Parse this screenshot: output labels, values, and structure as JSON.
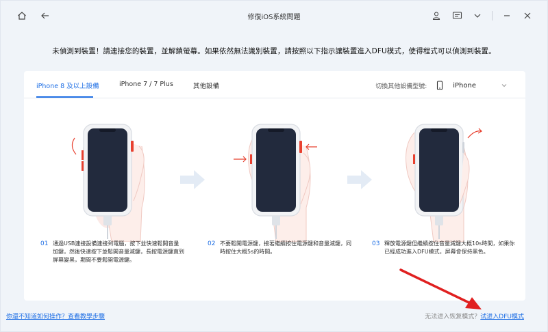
{
  "window": {
    "title": "修復iOS系統問題"
  },
  "notice": "未偵測到裝置！請連接您的裝置，並解鎖螢幕。如果依然無法識別裝置，請按照以下指示讓裝置進入DFU模式，使得程式可以偵測到裝置。",
  "tabs": [
    {
      "label": "iPhone 8 及以上設備"
    },
    {
      "label": "iPhone 7 / 7 Plus"
    },
    {
      "label": "其他設備"
    }
  ],
  "switcher": {
    "label": "切換其他設備型號:",
    "value": "iPhone"
  },
  "steps": [
    {
      "num": "01",
      "text": "通過USB連接設備連接到電腦，按下並快速鬆開音量加鍵，然後快速按下並鬆開音量減鍵，長按電源鍵直到屏幕變黑，期間不要鬆開電源鍵。"
    },
    {
      "num": "02",
      "text": "不要鬆開電源鍵，接著繼續按住電源鍵和音量減鍵，同時按住大概5s的時間。"
    },
    {
      "num": "03",
      "text": "釋放電源鍵但繼續按住音量減鍵大概10s時間，如果你已經成功進入DFU模式，屏幕會保持黑色。"
    }
  ],
  "footer": {
    "help_link": "你還不知道如何操作？查看教學步驟",
    "right_text": "无法进入恢复模式？",
    "right_link": "试进入DFU模式"
  },
  "colors": {
    "accent": "#1f6fe5",
    "background": "#f0f4f9",
    "alert_arrow": "#e02020"
  },
  "icons": [
    "home-icon",
    "back-arrow-icon",
    "user-icon",
    "feedback-icon",
    "chevron-down-icon",
    "minimize-icon",
    "close-icon",
    "phone-icon"
  ]
}
